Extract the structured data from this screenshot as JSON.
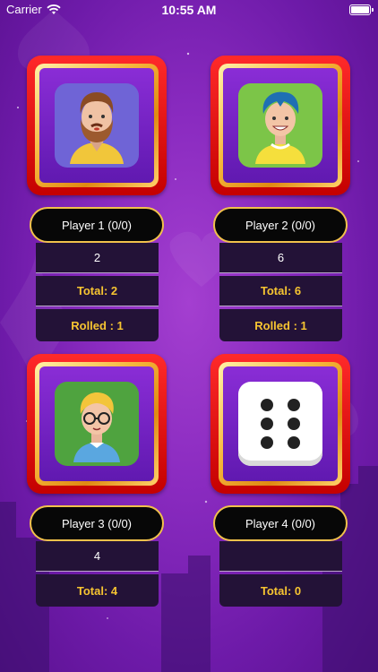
{
  "status_bar": {
    "carrier": "Carrier",
    "time": "10:55 AM"
  },
  "players": [
    {
      "name": "Player 1 (0/0)",
      "avatar": "bearded-man-avatar-icon",
      "tile_color": "#6f64d6",
      "roll": "2",
      "total": "Total: 2",
      "rolled": "Rolled : 1"
    },
    {
      "name": "Player 2 (0/0)",
      "avatar": "blue-hair-boy-avatar-icon",
      "tile_color": "#7cc548",
      "roll": "6",
      "total": "Total: 6",
      "rolled": "Rolled : 1"
    },
    {
      "name": "Player 3 (0/0)",
      "avatar": "glasses-boy-avatar-icon",
      "tile_color": "#4fa33f",
      "roll": "4",
      "total": "Total: 4",
      "rolled": ""
    },
    {
      "name": "Player 4 (0/0)",
      "avatar": "dice-six-icon",
      "tile_color": "#ffffff",
      "roll": "",
      "total": "Total: 0",
      "rolled": ""
    }
  ],
  "colors": {
    "pill_border": "#f1c14b",
    "stat_text": "#f6c431",
    "card_red": "#e00d0d"
  }
}
